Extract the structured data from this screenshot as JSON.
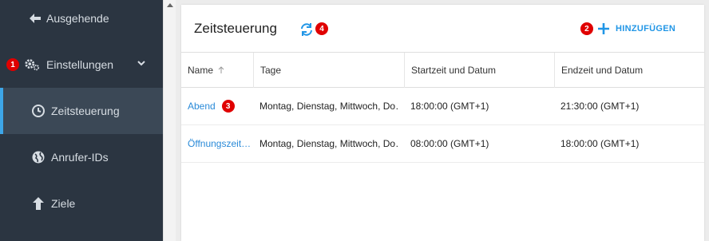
{
  "sidebar": {
    "items": [
      {
        "label": "Ausgehende",
        "icon": "arrow-left-icon"
      },
      {
        "label": "Einstellungen",
        "icon": "gears-icon",
        "badge": "1"
      },
      {
        "label": "Zeitsteuerung",
        "icon": "clock-icon",
        "active": true
      },
      {
        "label": "Anrufer-IDs",
        "icon": "globe-icon"
      },
      {
        "label": "Ziele",
        "icon": "arrow-up-icon"
      }
    ]
  },
  "main": {
    "title": "Zeitsteuerung",
    "refresh_badge": "4",
    "add_badge": "2",
    "add_label": "HINZUFÜGEN",
    "table": {
      "headers": [
        "Name",
        "Tage",
        "Startzeit und Datum",
        "Endzeit und Datum"
      ],
      "rows": [
        {
          "name": "Abend",
          "badge": "3",
          "days": "Montag, Dienstag, Mittwoch, Do…",
          "start": "18:00:00 (GMT+1)",
          "end": "21:30:00 (GMT+1)"
        },
        {
          "name": "Öffnungszeit…",
          "days": "Montag, Dienstag, Mittwoch, Do…",
          "start": "08:00:00 (GMT+1)",
          "end": "18:00:00 (GMT+1)"
        }
      ]
    }
  },
  "colors": {
    "sidebar_bg": "#2b3541",
    "sidebar_active_bg": "#3b4856",
    "accent": "#2196e6",
    "badge": "#e00000"
  }
}
